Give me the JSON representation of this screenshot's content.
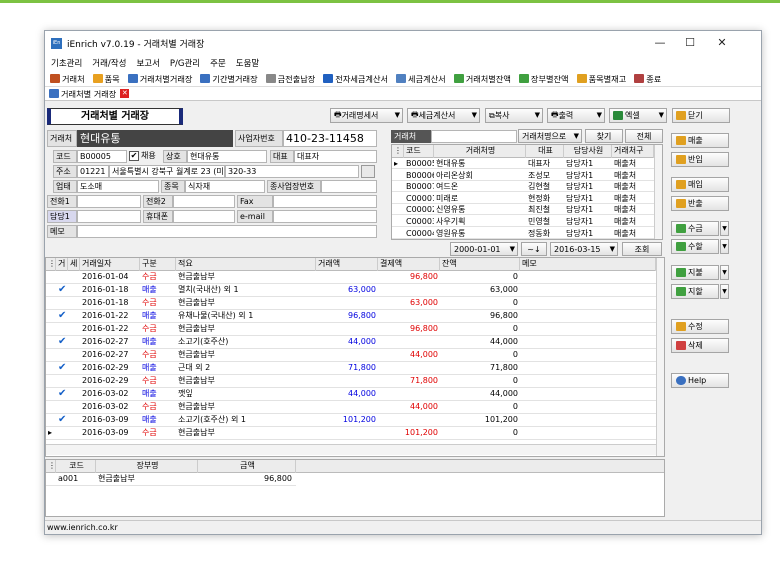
{
  "window": {
    "title": "iEnrich v7.0.19 - 거래처별 거래장",
    "app_icon": "iEn"
  },
  "menu": [
    "기초관리",
    "거래/작성",
    "보고서",
    "P/G관리",
    "주문",
    "도움말"
  ],
  "toolbar": [
    {
      "label": "거래처",
      "icon": "person-icon",
      "color": "#c05020"
    },
    {
      "label": "품목",
      "icon": "box-icon",
      "color": "#e8a020"
    },
    {
      "label": "거래처별거래장",
      "icon": "ledger-icon",
      "color": "#3a70c0"
    },
    {
      "label": "기간별거래장",
      "icon": "ledger-icon",
      "color": "#3a70c0"
    },
    {
      "label": "금전출납장",
      "icon": "cash-icon",
      "color": "#888888"
    },
    {
      "label": "전자세금계산서",
      "icon": "einvoice-icon",
      "color": "#2060c0"
    },
    {
      "label": "세금계산서",
      "icon": "invoice-icon",
      "color": "#5080c0"
    },
    {
      "label": "거래처별잔액",
      "icon": "balance-icon",
      "color": "#40a040"
    },
    {
      "label": "장부별잔액",
      "icon": "balance-icon",
      "color": "#40a040"
    },
    {
      "label": "품목별재고",
      "icon": "stock-icon",
      "color": "#e0a020"
    },
    {
      "label": "종료",
      "icon": "exit-icon",
      "color": "#b04040"
    }
  ],
  "doc_tab": {
    "label": "거래처별 거래장"
  },
  "page_title": "거래처별 거래장",
  "top_buttons": {
    "statement": "거래명세서",
    "tax_invoice": "세금계산서",
    "copy": "복사",
    "print": "출력",
    "excel": "엑셀",
    "close": "닫기"
  },
  "form": {
    "client_label": "거래처",
    "client_value": "현대유통",
    "biz_no_label": "사업자번호",
    "biz_no_value": "410-23-11458",
    "code_label": "코드",
    "code_value": "B00005",
    "use_label": "채용",
    "company_label": "상호",
    "company_value": "현대유통",
    "rep_label": "대표",
    "rep_value": "대표자",
    "addr_label": "주소",
    "zip_value": "01221",
    "addr_value": "서울특별시 강북구 월계로 23 (미",
    "addr2_value": "320-33",
    "biz_type_label": "업태",
    "biz_type_value": "도소매",
    "item_label": "종목",
    "item_value": "식자재",
    "biz_place_label": "종사업장번호",
    "phone1_label": "전화1",
    "phone2_label": "전화2",
    "fax_label": "Fax",
    "manager_label": "담당1",
    "mobile_label": "휴대폰",
    "email_label": "e-mail",
    "memo_label": "메모"
  },
  "client_search": {
    "label": "거래처",
    "mode": "거래처명으로",
    "find": "찾기",
    "all": "전체",
    "columns": [
      "코드",
      "거래처명",
      "대표",
      "담당사원",
      "거래처구"
    ],
    "rows": [
      [
        "B00005",
        "현대유통",
        "대표자",
        "담당자1",
        "매출처"
      ],
      [
        "B00006",
        "아리온상회",
        "조성모",
        "담당자1",
        "매출처"
      ],
      [
        "B00007",
        "여드온",
        "김현철",
        "담당자1",
        "매출처"
      ],
      [
        "C00001",
        "미래로",
        "현정화",
        "담당자1",
        "매출처"
      ],
      [
        "C00002",
        "신영유통",
        "최진철",
        "담당자1",
        "매출처"
      ],
      [
        "C00003",
        "사우기획",
        "민영철",
        "담당자1",
        "매출처"
      ],
      [
        "C00004",
        "영원유통",
        "정동화",
        "담당자1",
        "매출처"
      ]
    ]
  },
  "date_filter": {
    "from": "2000-01-01",
    "sep": "~↓",
    "to": "2016-03-15",
    "query": "조회"
  },
  "ledger": {
    "columns": [
      "거",
      "세",
      "거래일자",
      "구분",
      "적요",
      "거래액",
      "결제액",
      "잔액",
      "메모"
    ],
    "rows": [
      {
        "chk": false,
        "date": "2016-01-04",
        "type": "수금",
        "desc": "현금출납부",
        "amount": "",
        "paid": "96,800",
        "balance": "0"
      },
      {
        "chk": true,
        "date": "2016-01-18",
        "type": "매출",
        "desc": "멸치(국내산) 외 1",
        "amount": "63,000",
        "paid": "",
        "balance": "63,000"
      },
      {
        "chk": false,
        "date": "2016-01-18",
        "type": "수금",
        "desc": "현금출납부",
        "amount": "",
        "paid": "63,000",
        "balance": "0"
      },
      {
        "chk": true,
        "date": "2016-01-22",
        "type": "매출",
        "desc": "유채나물(국내산) 외 1",
        "amount": "96,800",
        "paid": "",
        "balance": "96,800"
      },
      {
        "chk": false,
        "date": "2016-01-22",
        "type": "수금",
        "desc": "현금출납부",
        "amount": "",
        "paid": "96,800",
        "balance": "0"
      },
      {
        "chk": true,
        "date": "2016-02-27",
        "type": "매출",
        "desc": "소고기(호주산)",
        "amount": "44,000",
        "paid": "",
        "balance": "44,000"
      },
      {
        "chk": false,
        "date": "2016-02-27",
        "type": "수금",
        "desc": "현금출납부",
        "amount": "",
        "paid": "44,000",
        "balance": "0"
      },
      {
        "chk": true,
        "date": "2016-02-29",
        "type": "매출",
        "desc": "근대 외 2",
        "amount": "71,800",
        "paid": "",
        "balance": "71,800"
      },
      {
        "chk": false,
        "date": "2016-02-29",
        "type": "수금",
        "desc": "현금출납부",
        "amount": "",
        "paid": "71,800",
        "balance": "0"
      },
      {
        "chk": true,
        "date": "2016-03-02",
        "type": "매출",
        "desc": "깻잎",
        "amount": "44,000",
        "paid": "",
        "balance": "44,000"
      },
      {
        "chk": false,
        "date": "2016-03-02",
        "type": "수금",
        "desc": "현금출납부",
        "amount": "",
        "paid": "44,000",
        "balance": "0"
      },
      {
        "chk": true,
        "date": "2016-03-09",
        "type": "매출",
        "desc": "소고기(호주산) 외 1",
        "amount": "101,200",
        "paid": "",
        "balance": "101,200"
      },
      {
        "chk": false,
        "date": "2016-03-09",
        "type": "수금",
        "desc": "현금출납부",
        "amount": "",
        "paid": "101,200",
        "balance": "0"
      }
    ]
  },
  "summary": {
    "columns": [
      "코드",
      "장부명",
      "금액"
    ],
    "rows": [
      [
        "a001",
        "현금출납부",
        "96,800"
      ]
    ]
  },
  "side_buttons": {
    "sales": "매출",
    "sales_return": "반입",
    "purchase": "매입",
    "purchase_return": "반출",
    "collect": "수금",
    "collect2": "수할",
    "pay": "지불",
    "pay2": "지할",
    "edit": "수정",
    "delete": "삭제",
    "help": "Help"
  },
  "status": {
    "url": "www.ienrich.co.kr"
  },
  "colors": {
    "sales": "#0000e0",
    "collect": "#e00000",
    "accent": "#7cc242"
  }
}
